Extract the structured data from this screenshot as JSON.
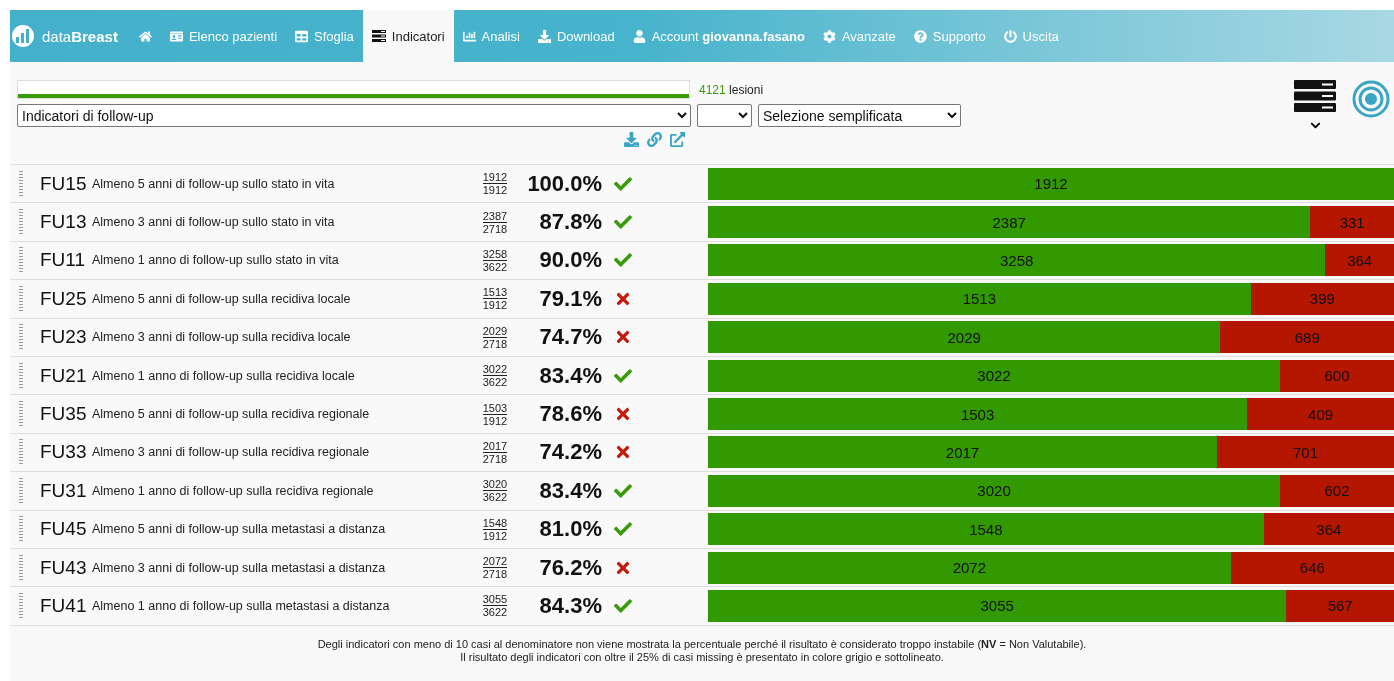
{
  "nav": {
    "brand": "data**Breast**",
    "items": [
      {
        "kind": "home",
        "selected": false
      },
      {
        "kind": "patients",
        "label": "Elenco pazienti",
        "selected": false
      },
      {
        "kind": "browse",
        "label": "Sfoglia",
        "selected": false
      },
      {
        "kind": "indicators",
        "label": "Indicatori",
        "selected": true
      },
      {
        "kind": "analysis",
        "label": "Analisi",
        "selected": false
      },
      {
        "kind": "download",
        "label": "Download",
        "selected": false
      },
      {
        "kind": "account",
        "label": "Account **giovanna.fasano**",
        "selected": false
      },
      {
        "kind": "settings",
        "label": "Avanzate",
        "selected": false
      },
      {
        "kind": "support",
        "label": "Supporto",
        "selected": false
      },
      {
        "kind": "logout",
        "label": "Uscita",
        "selected": false
      }
    ]
  },
  "progress": {
    "level": 1,
    "count": "4121",
    "unit": "lesioni"
  },
  "selects": {
    "indicator_set": "Indicatori di follow-up",
    "mode": "Selezione semplificata"
  },
  "rows": [
    {
      "code": "FU15",
      "label": "Almeno 5 anni di follow-up sullo stato in vita",
      "numerator": "1912",
      "denominator": "1912",
      "percent": "100.0%",
      "passed": true,
      "level": 1,
      "ok": "1912"
    },
    {
      "code": "FU13",
      "label": "Almeno 3 anni di follow-up sullo stato in vita",
      "numerator": "2387",
      "denominator": "2718",
      "percent": "87.8%",
      "passed": true,
      "level": 0.878,
      "ok": "2387",
      "missing": "331"
    },
    {
      "code": "FU11",
      "label": "Almeno 1 anno di follow-up sullo stato in vita",
      "numerator": "3258",
      "denominator": "3622",
      "percent": "90.0%",
      "passed": true,
      "level": 0.9,
      "ok": "3258",
      "missing": "364"
    },
    {
      "code": "FU25",
      "label": "Almeno 5 anni di follow-up sulla recidiva locale",
      "numerator": "1513",
      "denominator": "1912",
      "percent": "79.1%",
      "passed": false,
      "level": 0.791,
      "ok": "1513",
      "missing": "399"
    },
    {
      "code": "FU23",
      "label": "Almeno 3 anni di follow-up sulla recidiva locale",
      "numerator": "2029",
      "denominator": "2718",
      "percent": "74.7%",
      "passed": false,
      "level": 0.747,
      "ok": "2029",
      "missing": "689"
    },
    {
      "code": "FU21",
      "label": "Almeno 1 anno di follow-up sulla recidiva locale",
      "numerator": "3022",
      "denominator": "3622",
      "percent": "83.4%",
      "passed": true,
      "level": 0.834,
      "ok": "3022",
      "missing": "600"
    },
    {
      "code": "FU35",
      "label": "Almeno 5 anni di follow-up sulla recidiva regionale",
      "numerator": "1503",
      "denominator": "1912",
      "percent": "78.6%",
      "passed": false,
      "level": 0.786,
      "ok": "1503",
      "missing": "409"
    },
    {
      "code": "FU33",
      "label": "Almeno 3 anni di follow-up sulla recidiva regionale",
      "numerator": "2017",
      "denominator": "2718",
      "percent": "74.2%",
      "passed": false,
      "level": 0.742,
      "ok": "2017",
      "missing": "701"
    },
    {
      "code": "FU31",
      "label": "Almeno 1 anno di follow-up sulla recidiva regionale",
      "numerator": "3020",
      "denominator": "3622",
      "percent": "83.4%",
      "passed": true,
      "level": 0.834,
      "ok": "3020",
      "missing": "602"
    },
    {
      "code": "FU45",
      "label": "Almeno 5 anni di follow-up sulla metastasi a distanza",
      "numerator": "1548",
      "denominator": "1912",
      "percent": "81.0%",
      "passed": true,
      "level": 0.81,
      "ok": "1548",
      "missing": "364"
    },
    {
      "code": "FU43",
      "label": "Almeno 3 anni di follow-up sulla metastasi a distanza",
      "numerator": "2072",
      "denominator": "2718",
      "percent": "76.2%",
      "passed": false,
      "level": 0.762,
      "ok": "2072",
      "missing": "646"
    },
    {
      "code": "FU41",
      "label": "Almeno 1 anno di follow-up sulla metastasi a distanza",
      "numerator": "3055",
      "denominator": "3622",
      "percent": "84.3%",
      "passed": true,
      "level": 0.843,
      "ok": "3055",
      "missing": "567"
    }
  ],
  "notes": [
    "Degli indicatori con meno di 10 casi al denominatore non viene mostrata la percentuale perché il risultato è considerato troppo instabile (**NV** = Non Valutabile).",
    "Il risultato degli indicatori con oltre il 25% di casi missing è presentato in colore grigio e sottolineato."
  ]
}
